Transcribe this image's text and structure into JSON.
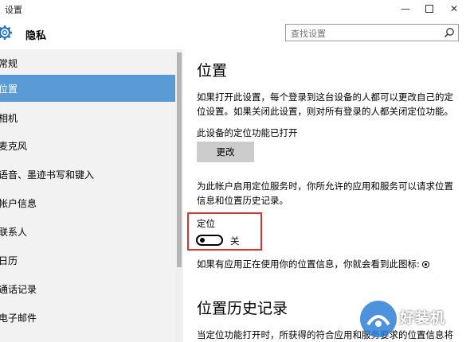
{
  "window": {
    "title": "设置",
    "minimize_icon": "minimize-icon",
    "maximize_icon": "maximize-icon",
    "close_icon": "close-icon"
  },
  "header": {
    "section_icon": "gear-icon",
    "section": "隐私",
    "search_placeholder": "查找设置",
    "search_icon": "search-icon"
  },
  "sidebar": {
    "items": [
      {
        "label": "常规",
        "active": false
      },
      {
        "label": "位置",
        "active": true
      },
      {
        "label": "相机",
        "active": false
      },
      {
        "label": "麦克风",
        "active": false
      },
      {
        "label": "语音、墨迹书写和键入",
        "active": false
      },
      {
        "label": "帐户信息",
        "active": false
      },
      {
        "label": "联系人",
        "active": false
      },
      {
        "label": "日历",
        "active": false
      },
      {
        "label": "通话记录",
        "active": false
      },
      {
        "label": "电子邮件",
        "active": false
      }
    ]
  },
  "content": {
    "title": "位置",
    "intro": "如果打开此设置，每个登录到这台设备的人都可以更改自己的定位设置。如果关闭此设置，则对所有登录的人都关闭定位功能。",
    "device_status": "此设备的定位功能已打开",
    "change_button": "更改",
    "account_desc": "为此帐户启用定位服务时，你所允许的应用和服务可以请求位置信息和位置历史记录。",
    "location_label": "定位",
    "toggle_state": "关",
    "toggle_on": false,
    "in_use_text": "如果有应用正在使用你的位置信息，你就会看到此图标:",
    "in_use_icon": "location-in-use-icon",
    "history_title": "位置历史记录",
    "history_desc": "当定位功能打开时，所获得的符合应用和服务要求的位置信息将"
  },
  "colors": {
    "accent": "#5b9bd5",
    "sidebar_bg": "#f2f2f2",
    "button_bg": "#cccccc",
    "highlight_border": "#d9342b"
  },
  "watermark": {
    "text": "好装机"
  }
}
